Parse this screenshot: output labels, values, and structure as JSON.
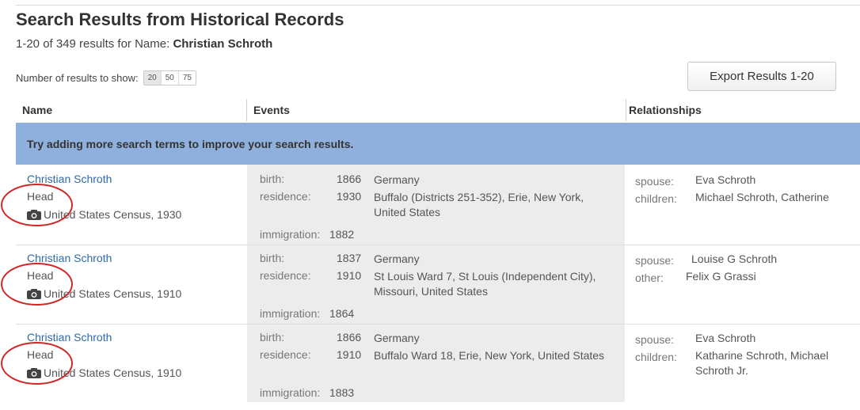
{
  "page_title": "Search Results from Historical Records",
  "summary": {
    "range_text": "1-20 of 349 results for Name:",
    "query_name": "Christian Schroth"
  },
  "results_per_page": {
    "label": "Number of results to show:",
    "options": [
      "20",
      "50",
      "75"
    ],
    "selected": "20"
  },
  "export_label": "Export Results 1-20",
  "columns": [
    "Name",
    "Events",
    "Relationships"
  ],
  "banner_text": "Try adding more search terms to improve your search results.",
  "colors": {
    "link": "#2e6aa8",
    "banner": "#8fb0dc",
    "annotation": "#cf2828"
  },
  "results": [
    {
      "name": "Christian Schroth",
      "role": "Head",
      "collection": "United States Census, 1930",
      "events": [
        {
          "label": "birth:",
          "year": "1866",
          "place": "Germany"
        },
        {
          "label": "residence:",
          "year": "1930",
          "place": "Buffalo (Districts 251-352), Erie, New York, United States"
        },
        {
          "label": "immigration:",
          "year": "1882",
          "place": ""
        }
      ],
      "relationships": [
        {
          "label": "spouse:",
          "value": "Eva Schroth"
        },
        {
          "label": "children:",
          "value": "Michael Schroth, Catherine"
        }
      ]
    },
    {
      "name": "Christian Schroth",
      "role": "Head",
      "collection": "United States Census, 1910",
      "events": [
        {
          "label": "birth:",
          "year": "1837",
          "place": "Germany"
        },
        {
          "label": "residence:",
          "year": "1910",
          "place": "St Louis Ward 7, St Louis (Independent City), Missouri, United States"
        },
        {
          "label": "immigration:",
          "year": "1864",
          "place": ""
        }
      ],
      "relationships": [
        {
          "label": "spouse:",
          "value": "Louise G Schroth"
        },
        {
          "label": "other:",
          "value": "Felix G Grassi"
        }
      ]
    },
    {
      "name": "Christian Schroth",
      "role": "Head",
      "collection": "United States Census, 1910",
      "events": [
        {
          "label": "birth:",
          "year": "1866",
          "place": "Germany"
        },
        {
          "label": "residence:",
          "year": "1910",
          "place": "Buffalo Ward 18, Erie, New York, United States"
        },
        {
          "label": "immigration:",
          "year": "1883",
          "place": ""
        }
      ],
      "relationships": [
        {
          "label": "spouse:",
          "value": "Eva Schroth"
        },
        {
          "label": "children:",
          "value": "Katharine Schroth, Michael Schroth Jr."
        }
      ]
    }
  ]
}
